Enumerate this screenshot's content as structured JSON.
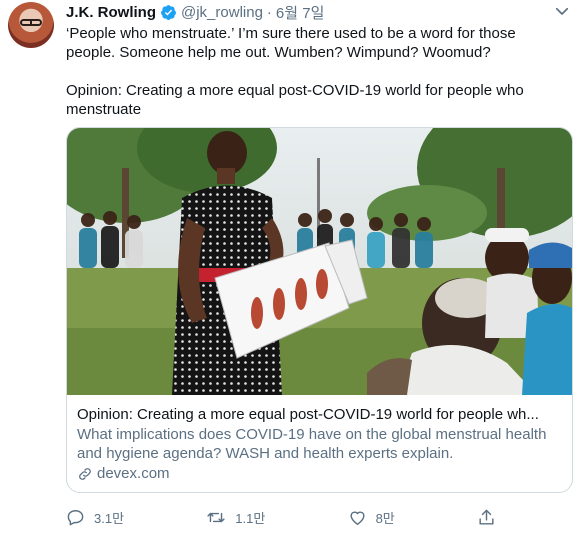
{
  "tweet": {
    "author_name": "J.K. Rowling",
    "handle": "@jk_rowling",
    "separator": "·",
    "date": "6월 7일",
    "text_line1": "‘People who menstruate.’ I’m sure there used to be a word for those people. Someone help me out. Wumben? Wimpund? Woomud?",
    "text_line2": "Opinion: Creating a more equal post-COVID-19 world for people who menstruate"
  },
  "card": {
    "title": "Opinion: Creating a more equal post-COVID-19 world for people wh...",
    "description": "What implications does COVID-19 have on the global menstrual health and hygiene agenda? WASH and health experts explain.",
    "domain": "devex.com"
  },
  "actions": {
    "reply_count": "3.1만",
    "retweet_count": "1.1만",
    "like_count": "8만"
  },
  "icons": {
    "verified": "verified-badge-icon",
    "more": "more-icon",
    "link": "link-icon",
    "reply": "reply-icon",
    "retweet": "retweet-icon",
    "like": "like-icon",
    "share": "share-icon"
  },
  "colors": {
    "text": "#0f1419",
    "secondary": "#5b7083",
    "verified": "#1da1f2",
    "border": "#cfd9de"
  }
}
